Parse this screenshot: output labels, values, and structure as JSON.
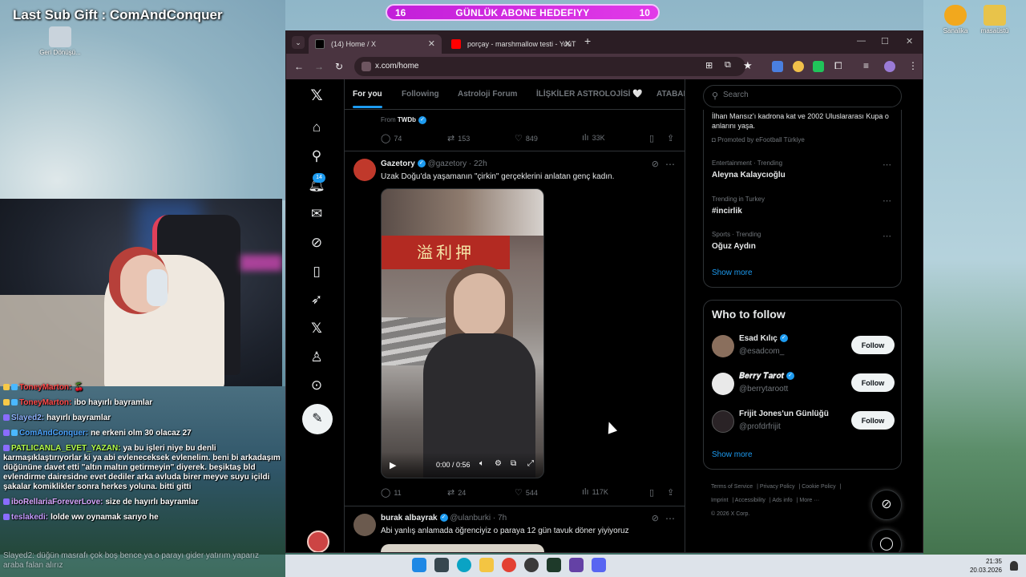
{
  "stream": {
    "sub_gift": "Last Sub Gift : ComAndConquer",
    "goal": {
      "left": "16",
      "title": "GÜNLÜK ABONE HEDEFIYY",
      "right": "10"
    },
    "desktop_icons": [
      {
        "label": "Geri Dönüşü...",
        "color": "#c9d3dc"
      },
      {
        "label": "Sanalika",
        "color": "#f2a81d"
      },
      {
        "label": "masaüstü",
        "color": "#e8c34a"
      }
    ],
    "chat": [
      {
        "user": "ToneyMarton:",
        "color": "#ff4a4a",
        "text": "🍒"
      },
      {
        "user": "ToneyMarton:",
        "color": "#ff4a4a",
        "text": "ibo hayırlı bayramlar"
      },
      {
        "user": "Slayed2:",
        "color": "#8fb4ff",
        "text": "hayırlı bayramlar"
      },
      {
        "user": "ComAndConquer:",
        "color": "#4aa3ff",
        "text": "ne erkeni olm 30 olacaz 27"
      },
      {
        "user": "PATLICANLA_EVET_YAZAN:",
        "color": "#b4ff4a",
        "text": "ya bu işleri niye bu denli karmaşıklaştırıyorlar ki ya abi evleneceksek evlenelim. beni bi arkadaşım düğününe davet etti \"altın maltın getirmeyin\" diyerek. beşiktaş bld evlendirme dairesidne evet dediler arka avluda birer meyve suyu içildi şakalar komiklikler sonra herkes yoluna. bitti gitti"
      },
      {
        "user": "iboRellariaForeverLove:",
        "color": "#d9a7ff",
        "text": "size de hayırlı bayramlar"
      },
      {
        "user": "teslakedi:",
        "color": "#c59bff",
        "text": "lolde ww oynamak sarıyo he"
      }
    ],
    "chat_ghost": "Slayed2: düğün masrafı çok boş bence ya o parayı gider yatırım yaparız araba falan alırız"
  },
  "taskbar": {
    "time": "21:35",
    "date": "20.03.2026"
  },
  "browser": {
    "tabs": [
      {
        "title": "(14) Home / X",
        "favicon_color": "#000000"
      },
      {
        "title": "porçay - marshmallow testi - YouT",
        "favicon_color": "#ff0000"
      }
    ],
    "url": "x.com/home"
  },
  "x": {
    "notif_count": "14",
    "feed_tabs": [
      "For you",
      "Following",
      "Astroloji Forum",
      "İLİŞKİLER ASTROLOJİSİ 🤍",
      "ATABAR"
    ],
    "prev_post": {
      "from_label": "From",
      "from": "TWDb",
      "replies": "74",
      "reposts": "153",
      "likes": "849",
      "views": "33K"
    },
    "post1": {
      "name": "Gazetory",
      "handle": "@gazetory",
      "time": "· 22h",
      "text": "Uzak Doğu'da yaşamanın \"çirkin\" gerçeklerini anlatan genç kadın.",
      "video_sign": "溢利押",
      "video_time": "0:00 / 0:56",
      "replies": "11",
      "reposts": "24",
      "likes": "544",
      "views": "117K"
    },
    "post2": {
      "name": "burak albayrak",
      "handle": "@ulanburki",
      "time": "· 7h",
      "text": "Abi yanlış anlamada öğrenciyiz o paraya 12 gün tavuk döner yiyiyoruz"
    },
    "search_placeholder": "Search",
    "promo_text": "İlhan Mansız'ı kadrona kat ve 2002 Uluslararası Kupa o anlarını yaşa.",
    "promo_by": "Promoted by eFootball Türkiye",
    "trends": [
      {
        "category": "Entertainment · Trending",
        "title": "Aleyna Kalaycıoğlu"
      },
      {
        "category": "Trending in Turkey",
        "title": "#incirlik"
      },
      {
        "category": "Sports · Trending",
        "title": "Oğuz Aydın"
      }
    ],
    "show_more": "Show more",
    "who_to_follow": "Who to follow",
    "follow_suggestions": [
      {
        "name": "Esad Kılıç",
        "handle": "@esadcom_",
        "avatar_color": "#8a6f5d"
      },
      {
        "name": "𝑩𝒆𝒓𝒓𝒚 𝑻𝒂𝒓𝒐𝒕",
        "handle": "@berrytaroott",
        "avatar_color": "#e9e9e9"
      },
      {
        "name": "Frijit Jones'un Günlüğü",
        "handle": "@profdrfrijit",
        "avatar_color": "#2a2326"
      }
    ],
    "follow_label": "Follow",
    "footer": [
      "Terms of Service",
      "Privacy Policy",
      "Cookie Policy",
      "Imprint",
      "Accessibility",
      "Ads info",
      "More ···",
      "© 2026 X Corp."
    ]
  }
}
